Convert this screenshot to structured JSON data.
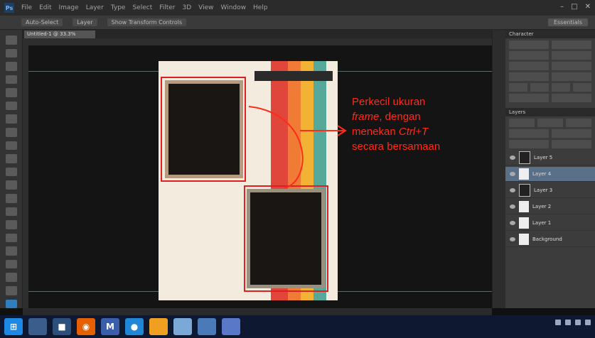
{
  "menubar": {
    "app_logo": "Ps",
    "menus": [
      "File",
      "Edit",
      "Image",
      "Layer",
      "Type",
      "Select",
      "Filter",
      "3D",
      "View",
      "Window",
      "Help"
    ]
  },
  "options_bar": {
    "items": [
      "Auto-Select",
      "Layer",
      "Show Transform Controls"
    ],
    "workspace": "Essentials"
  },
  "document": {
    "tab_label": "Untitled-1 @ 33.3%"
  },
  "annotation": {
    "line1": "Perkecil ukuran",
    "line2_em": "frame",
    "line2_rest": ", dengan",
    "line3_pre": "menekan ",
    "line3_em": "Ctrl+T",
    "line4": "secara bersamaan",
    "color": "#ff2a1a"
  },
  "panels": {
    "character_tab": "Character",
    "layers_tab": "Layers",
    "layers": [
      {
        "name": "Layer 5",
        "selected": false
      },
      {
        "name": "Layer 4",
        "selected": true
      },
      {
        "name": "Layer 3",
        "selected": false
      },
      {
        "name": "Layer 2",
        "selected": false
      },
      {
        "name": "Layer 1",
        "selected": false
      },
      {
        "name": "Background",
        "selected": false
      }
    ]
  },
  "colors": {
    "stripe_red": "#e0473a",
    "stripe_orange": "#ef7b35",
    "stripe_yellow": "#f2b335",
    "stripe_teal": "#56a89a",
    "highlight_red": "#e02020"
  },
  "taskbar": {
    "icons": [
      "windows-icon",
      "file-explorer-icon",
      "media-player-icon",
      "firefox-icon",
      "mail-icon",
      "chrome-icon",
      "folder-icon",
      "photos-icon",
      "desktop-icon",
      "photoshop-icon"
    ]
  }
}
